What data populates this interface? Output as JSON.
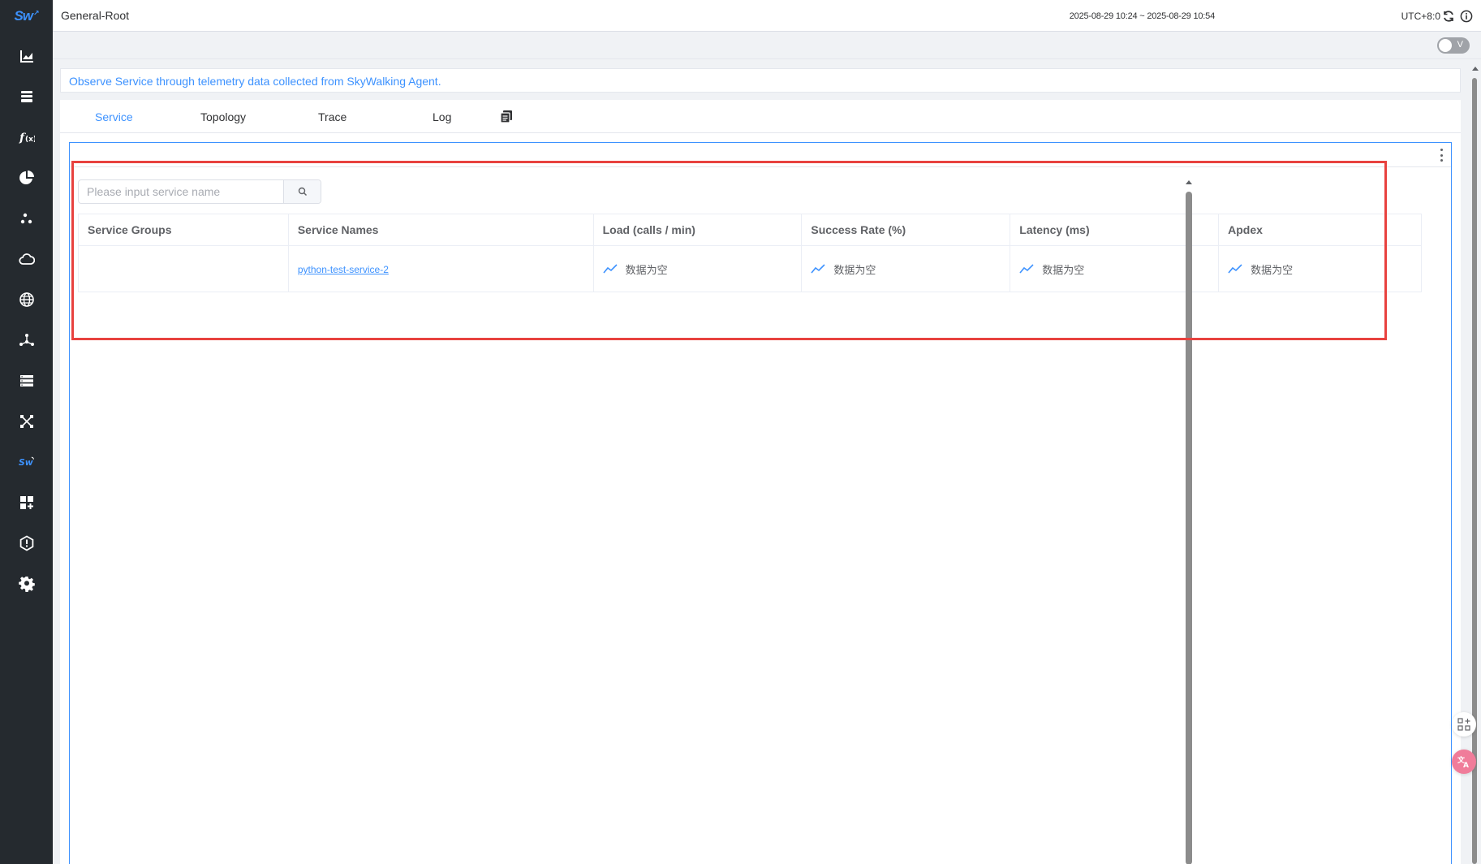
{
  "sidebar": {
    "logo": "Sw",
    "items": [
      {
        "name": "sidebar-item-general-service",
        "icon": "chart-icon"
      },
      {
        "name": "sidebar-item-database",
        "icon": "database-icon"
      },
      {
        "name": "sidebar-item-functions",
        "icon": "function-icon"
      },
      {
        "name": "sidebar-item-visual-database",
        "icon": "pie-icon"
      },
      {
        "name": "sidebar-item-service-mesh",
        "icon": "mesh-icon"
      },
      {
        "name": "sidebar-item-kubernetes",
        "icon": "cloud-icon"
      },
      {
        "name": "sidebar-item-infrastructure",
        "icon": "globe-icon"
      },
      {
        "name": "sidebar-item-gateway",
        "icon": "gateway-icon"
      },
      {
        "name": "sidebar-item-mq",
        "icon": "server-icon"
      },
      {
        "name": "sidebar-item-self-observability",
        "icon": "network-icon"
      },
      {
        "name": "sidebar-item-skywalking",
        "icon": "skywalking-icon"
      },
      {
        "name": "sidebar-item-dashboard",
        "icon": "dashboard-icon"
      },
      {
        "name": "sidebar-item-alerting",
        "icon": "alert-icon"
      },
      {
        "name": "sidebar-item-settings",
        "icon": "gear-icon"
      }
    ]
  },
  "header": {
    "title": "General-Root",
    "time_range": "2025-08-29 10:24 ~ 2025-08-29 10:54",
    "timezone": "UTC+8:0"
  },
  "toggle": {
    "label": "V"
  },
  "description": "Observe Service through telemetry data collected from SkyWalking Agent.",
  "tabs": [
    {
      "label": "Service",
      "active": true
    },
    {
      "label": "Topology",
      "active": false
    },
    {
      "label": "Trace",
      "active": false
    },
    {
      "label": "Log",
      "active": false
    }
  ],
  "search": {
    "placeholder": "Please input service name",
    "value": ""
  },
  "table": {
    "headers": [
      "Service Groups",
      "Service Names",
      "Load (calls / min)",
      "Success Rate (%)",
      "Latency (ms)",
      "Apdex"
    ],
    "rows": [
      {
        "group": "",
        "service": "python-test-service-2",
        "load": "数据为空",
        "success_rate": "数据为空",
        "latency": "数据为空",
        "apdex": "数据为空"
      }
    ]
  },
  "colors": {
    "accent": "#3d92ff",
    "sidebar_bg": "#252a2f",
    "highlight": "#e8423f"
  }
}
